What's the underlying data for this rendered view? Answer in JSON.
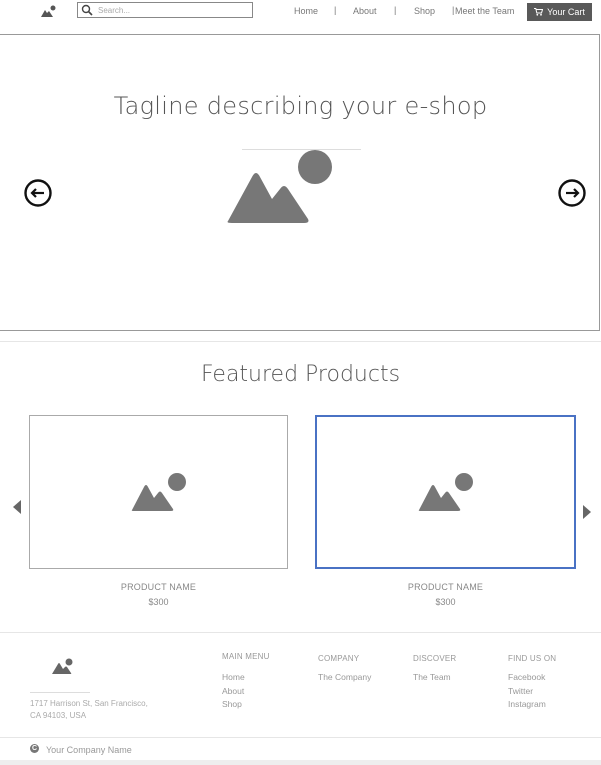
{
  "header": {
    "search_placeholder": "Search...",
    "nav": [
      {
        "label": "Home"
      },
      {
        "label": "About"
      },
      {
        "label": "Shop"
      },
      {
        "label": "Meet the Team"
      }
    ],
    "separators": [
      "|",
      "|",
      "|"
    ],
    "cart_label": "Your Cart"
  },
  "hero": {
    "tagline": "Tagline describing your e-shop"
  },
  "featured": {
    "title": "Featured Products",
    "products": [
      {
        "name": "PRODUCT NAME",
        "price": "$300"
      },
      {
        "name": "PRODUCT NAME",
        "price": "$300"
      }
    ]
  },
  "footer": {
    "address_line1": "1717 Harrison St, San Francisco,",
    "address_line2": "CA 94103, USA",
    "columns": [
      {
        "heading": "MAIN MENU",
        "links": [
          "Home",
          "About",
          "Shop"
        ]
      },
      {
        "heading": "COMPANY",
        "links": [
          "The Company"
        ]
      },
      {
        "heading": "DISCOVER",
        "links": [
          "The Team"
        ]
      },
      {
        "heading": "FIND US ON",
        "links": [
          "Facebook",
          "Twitter",
          "Instagram"
        ]
      }
    ],
    "copyright_symbol": "C",
    "company_name": "Your Company Name"
  },
  "colors": {
    "accent_selected_border": "#4a72c4",
    "cart_button": "#595959",
    "placeholder_image": "#777777"
  }
}
